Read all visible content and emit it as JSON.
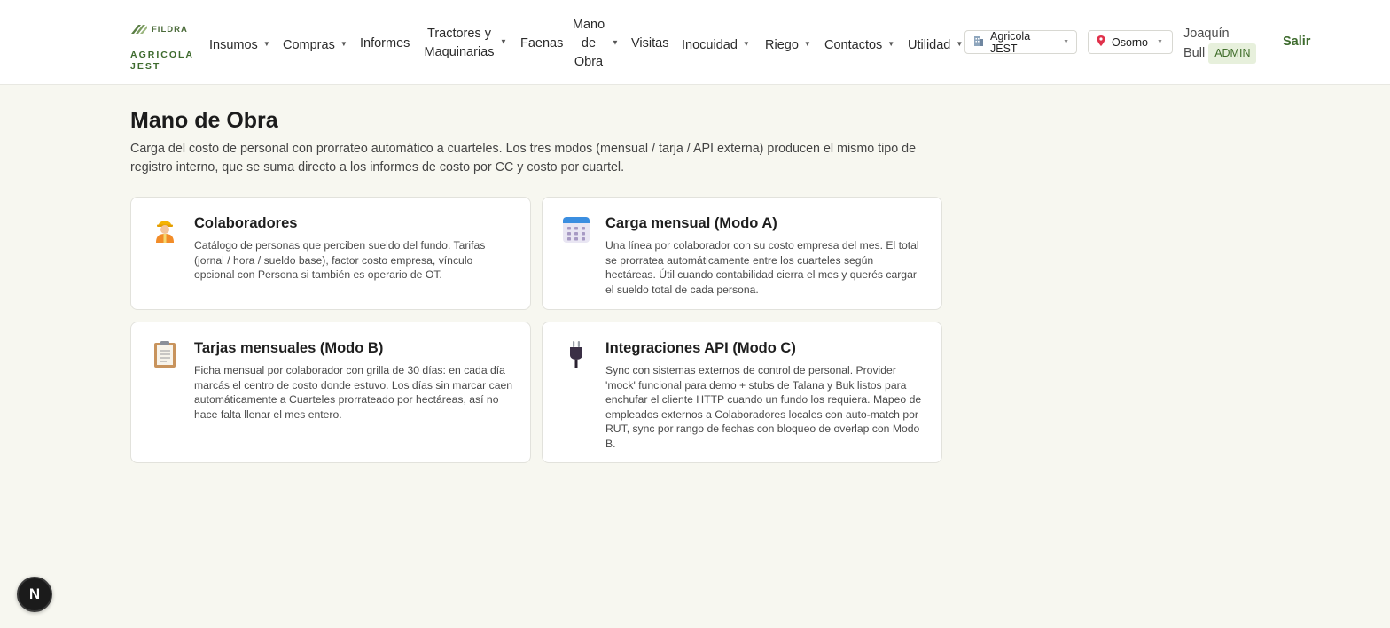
{
  "brand": {
    "name": "FILDRA",
    "tenant": "AGRICOLA JEST",
    "color": "#3e6b2e"
  },
  "nav": {
    "insumos": "Insumos",
    "compras": "Compras",
    "informes": "Informes",
    "tractores_l1": "Tractores y",
    "tractores_l2": "Maquinarias",
    "faenas": "Faenas",
    "mano_l1": "Mano",
    "mano_l2": "de",
    "mano_l3": "Obra",
    "visitas": "Visitas",
    "inocuidad": "Inocuidad",
    "riego": "Riego",
    "contactos": "Contactos",
    "utilidad": "Utilidad"
  },
  "selectors": {
    "company": {
      "label": "Agricola JEST",
      "icon": "building-icon"
    },
    "location": {
      "label": "Osorno",
      "icon": "pin-icon"
    }
  },
  "user": {
    "first": "Joaquín",
    "last": "Bull",
    "role": "ADMIN"
  },
  "logout": "Salir",
  "page": {
    "title": "Mano de Obra",
    "description": "Carga del costo de personal con prorrateo automático a cuarteles. Los tres modos (mensual / tarja / API externa) producen el mismo tipo de registro interno, que se suma directo a los informes de costo por CC y costo por cuartel."
  },
  "cards": [
    {
      "title": "Colaboradores",
      "icon": "worker-icon",
      "desc": "Catálogo de personas que perciben sueldo del fundo. Tarifas (jornal / hora / sueldo base), factor costo empresa, vínculo opcional con Persona si también es operario de OT."
    },
    {
      "title": "Carga mensual (Modo A)",
      "icon": "calendar-icon",
      "desc": "Una línea por colaborador con su costo empresa del mes. El total se prorratea automáticamente entre los cuarteles según hectáreas. Útil cuando contabilidad cierra el mes y querés cargar el sueldo total de cada persona."
    },
    {
      "title": "Tarjas mensuales (Modo B)",
      "icon": "clipboard-icon",
      "desc": "Ficha mensual por colaborador con grilla de 30 días: en cada día marcás el centro de costo donde estuvo. Los días sin marcar caen automáticamente a Cuarteles prorrateado por hectáreas, así no hace falta llenar el mes entero."
    },
    {
      "title": "Integraciones API (Modo C)",
      "icon": "plug-icon",
      "desc": "Sync con sistemas externos de control de personal. Provider 'mock' funcional para demo + stubs de Talana y Buk listos para enchufar el cliente HTTP cuando un fundo los requiera. Mapeo de empleados externos a Colaboradores locales con auto-match por RUT, sync por rango de fechas con bloqueo de overlap con Modo B."
    }
  ],
  "dev_badge": "N"
}
